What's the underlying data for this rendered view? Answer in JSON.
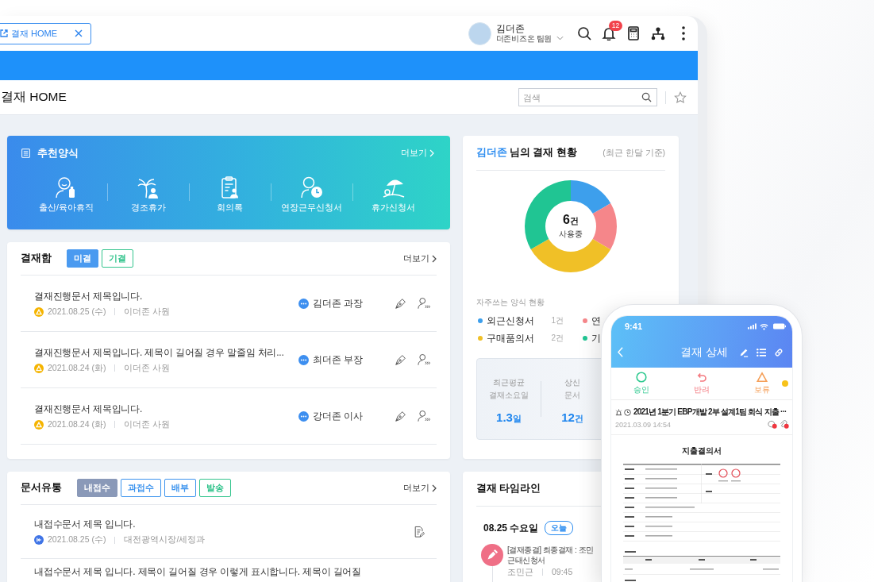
{
  "top_bar": {
    "tab": {
      "label": "결재 HOME"
    },
    "user": {
      "name": "김더존",
      "role": "더존비즈온 팀원"
    },
    "notification_count": "12"
  },
  "page": {
    "title": "결재 HOME",
    "search": {
      "placeholder": "검색"
    }
  },
  "recommended_forms": {
    "title": "추천양식",
    "more": "더보기",
    "items": [
      {
        "label": "출산/육아휴직",
        "kind": "parental"
      },
      {
        "label": "경조휴가",
        "kind": "condolence"
      },
      {
        "label": "회의록",
        "kind": "minutes"
      },
      {
        "label": "연장근무신청서",
        "kind": "overtime"
      },
      {
        "label": "휴가신청서",
        "kind": "vacation"
      }
    ]
  },
  "approval_box": {
    "title": "결재함",
    "more": "더보기",
    "tabs": [
      {
        "label": "미결",
        "selected": true,
        "color": "#4a9af0"
      },
      {
        "label": "기결",
        "selected": false,
        "color": "#33c48d"
      }
    ],
    "rows": [
      {
        "title": "결재진행문서 제목입니다.",
        "date": "2021.08.25 (수)",
        "author": "이더존 사원",
        "approver": "김더존 과장"
      },
      {
        "title": "결재진행문서 제목입니다. 제목이 길어질 경우 말줄임 처리...",
        "date": "2021.08.24 (화)",
        "author": "이더존 사원",
        "approver": "최더존 부장"
      },
      {
        "title": "결재진행문서 제목입니다.",
        "date": "2021.08.24 (화)",
        "author": "이더존 사원",
        "approver": "강더존 이사"
      }
    ]
  },
  "document_flow": {
    "title": "문서유통",
    "more": "더보기",
    "tabs": [
      {
        "label": "내접수",
        "selected": true,
        "color": "#8a99b8"
      },
      {
        "label": "과접수",
        "selected": false,
        "color": "#3d94ee"
      },
      {
        "label": "배부",
        "selected": false,
        "color": "#3d94ee"
      },
      {
        "label": "발송",
        "selected": false,
        "color": "#33c48d"
      }
    ],
    "rows": [
      {
        "title": "내접수문서 제목 입니다.",
        "date": "2021.08.25 (수)",
        "sender": "대전광역시장/세정과"
      },
      {
        "title": "내접수문서 제목 입니다. 제목이 길어질 경우 이렇게 표시합니다. 제목이 길어질"
      }
    ]
  },
  "status": {
    "user_name": "김더존",
    "title": "님의 결재 현황",
    "period": "(최근 한달 기준)",
    "total": {
      "value": "6",
      "unit": "건",
      "label": "사용중"
    },
    "chart_data": {
      "type": "donut",
      "categories": [
        "외근신청서",
        "연",
        "구매품의서",
        "기"
      ],
      "values": [
        16.7,
        16.7,
        33.3,
        33.3
      ]
    },
    "legend_title": "자주쓰는 양식 현황",
    "legend": [
      {
        "count": "1건",
        "color": "#3d9fec"
      },
      {
        "color": "#f5868a"
      },
      {
        "count": "2건",
        "color": "#f0c027"
      },
      {
        "color": "#20c593"
      }
    ],
    "stats": [
      {
        "label": "최근평균\n결재소요일",
        "value": "1.3",
        "unit": "일"
      },
      {
        "label": "상신\n문서",
        "value": "12",
        "unit": "건"
      }
    ]
  },
  "timeline": {
    "title": "결재 타임라인",
    "date": "08.25 수요일",
    "today": "오늘",
    "items": [
      {
        "title": "[결재종결] 최종결재 : 조민",
        "subtitle": "근태신청서",
        "person": "조민근",
        "time": "09:45"
      }
    ]
  },
  "phone": {
    "time": "9:41",
    "title": "결재 상세",
    "actions": [
      {
        "label": "승인",
        "kind": "approve",
        "color": "#2ec98f"
      },
      {
        "label": "반려",
        "kind": "reject",
        "color": "#f47a80"
      },
      {
        "label": "보류",
        "kind": "hold",
        "color": "#f5a05a"
      }
    ],
    "document": {
      "title": "2021년 1분기 EBP개발 2부 설계1팀 회식 지출 ···",
      "datetime": "2021.03.09 14:54",
      "form_title": "지출결의서"
    }
  }
}
